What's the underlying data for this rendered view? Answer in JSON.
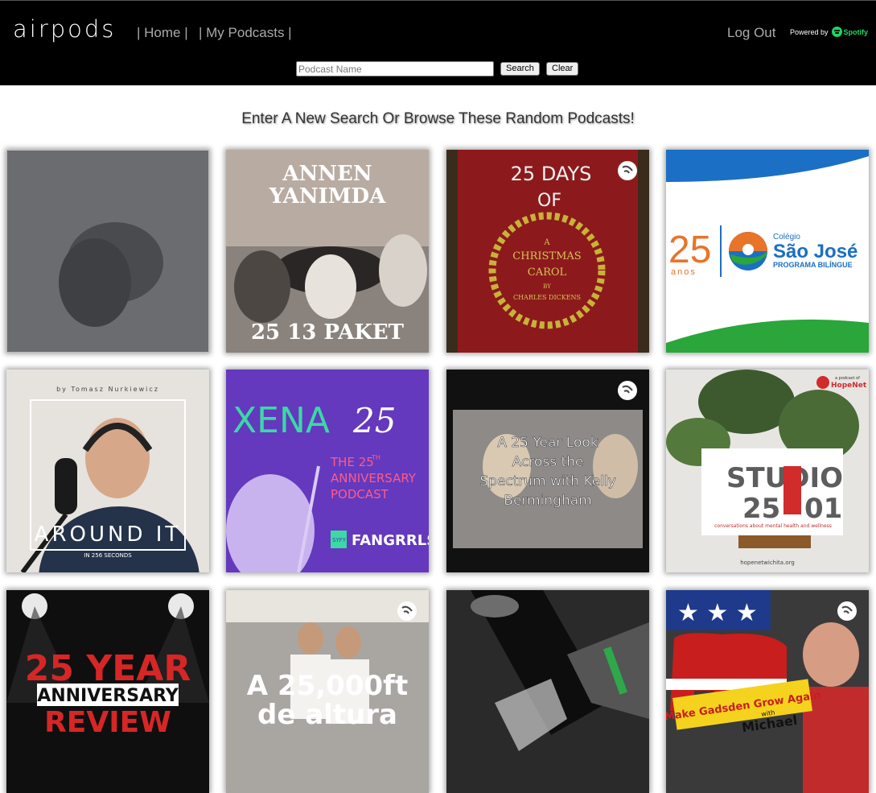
{
  "app": {
    "logo_text": "airpods",
    "nav": {
      "home": "| Home |",
      "my_podcasts": "| My Podcasts |"
    },
    "logout": "Log Out",
    "powered_by": "Powered by",
    "spotify_text": "Spotify"
  },
  "search": {
    "placeholder": "Podcast Name",
    "value": "",
    "search_label": "Search",
    "clear_label": "Clear"
  },
  "main": {
    "heading": "Enter A New Search Or Browse These Random Podcasts!",
    "podcasts": [
      {
        "lines": []
      },
      {
        "lines": [
          "ANNEN",
          "YANIMDA",
          "25 13 PAKET"
        ]
      },
      {
        "lines": [
          "25 DAYS",
          "OF",
          "A",
          "CHRISTMAS",
          "CAROL",
          "BY",
          "CHARLES DICKENS"
        ]
      },
      {
        "lines": [
          "25",
          "anos",
          "Colégio",
          "São José",
          "PROGRAMA BILÍNGUE"
        ]
      },
      {
        "lines": [
          "by Tomasz Nurkiewicz",
          "AROUND IT",
          "IN 256 SECONDS"
        ]
      },
      {
        "lines": [
          "XENA",
          "25",
          "THE 25",
          "TH",
          "ANNIVERSARY",
          "PODCAST",
          "SYFY",
          "FANGRRLS"
        ]
      },
      {
        "lines": [
          "A 25 Year Look",
          "Across the",
          "Spectrum with Kelly",
          "Bermingham"
        ]
      },
      {
        "lines": [
          "a podcast of",
          "HopeNet",
          "STUDIO",
          "25",
          "01",
          "conversations about mental health and wellness",
          "hopenetwichita.org"
        ]
      },
      {
        "lines": [
          "25 YEAR",
          "ANNIVERSARY",
          "REVIEW"
        ]
      },
      {
        "lines": [
          "A 25,000ft",
          "de altura"
        ]
      },
      {
        "lines": []
      },
      {
        "lines": [
          "Make Gadsden Grow Again",
          "with",
          "Michael"
        ]
      }
    ]
  }
}
